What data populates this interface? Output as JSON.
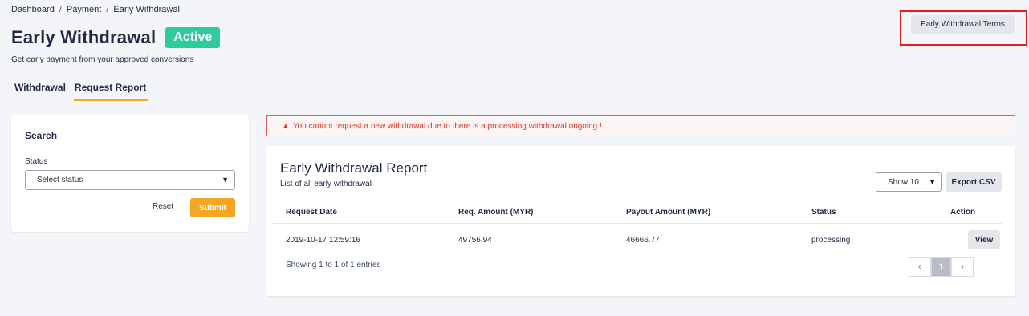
{
  "breadcrumb": {
    "items": [
      "Dashboard",
      "Payment",
      "Early Withdrawal"
    ],
    "separator": "/"
  },
  "page": {
    "title": "Early Withdrawal",
    "badge": "Active",
    "badge_color": "#2ecc9a",
    "subtitle": "Get early payment from your approved conversions"
  },
  "terms_button": {
    "label": "Early Withdrawal Terms"
  },
  "tabs": [
    {
      "label": "Withdrawal",
      "active": false
    },
    {
      "label": "Request Report",
      "active": true
    }
  ],
  "search": {
    "title": "Search",
    "status_label": "Status",
    "status_value": "Select status",
    "reset_label": "Reset",
    "submit_label": "Submit",
    "accent_color": "#f5a623"
  },
  "alert": {
    "icon": "warning-icon",
    "message": "You cannot request a new withdrawal due to there is a processing withdrawal ongoing !"
  },
  "report": {
    "title": "Early Withdrawal Report",
    "subtitle": "List of all early withdrawal",
    "page_size": "Show 10",
    "export_label": "Export CSV",
    "columns": [
      "Request Date",
      "Req. Amount (MYR)",
      "Payout Amount (MYR)",
      "Status",
      "Action"
    ],
    "rows": [
      {
        "request_date": "2019-10-17 12:59:16",
        "req_amount": "49756.94",
        "payout_amount": "46666.77",
        "status": "processing",
        "action": "View"
      }
    ],
    "showing": "Showing 1 to 1 of 1 entries",
    "pagination": {
      "prev": "‹",
      "current": "1",
      "next": "›"
    }
  }
}
